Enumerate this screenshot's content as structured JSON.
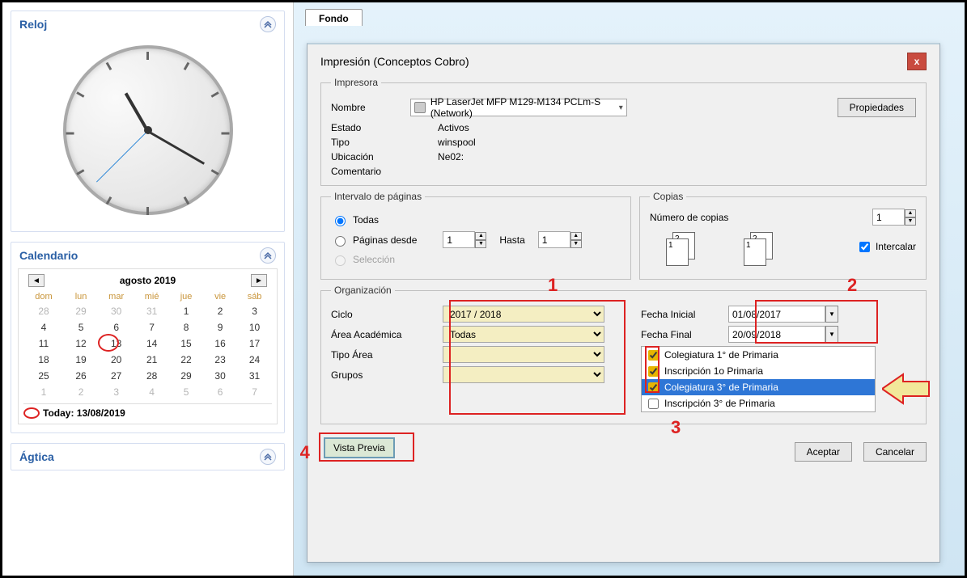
{
  "sidebar": {
    "clock_title": "Reloj",
    "calendar_title": "Calendario",
    "agtica_title": "Ágtica",
    "calendar": {
      "month_label": "agosto 2019",
      "today_label": "Today: 13/08/2019",
      "dow": [
        "dom",
        "lun",
        "mar",
        "mié",
        "jue",
        "vie",
        "sáb"
      ],
      "weeks": [
        [
          {
            "d": "28",
            "dim": true
          },
          {
            "d": "29",
            "dim": true
          },
          {
            "d": "30",
            "dim": true
          },
          {
            "d": "31",
            "dim": true
          },
          {
            "d": "1"
          },
          {
            "d": "2"
          },
          {
            "d": "3"
          }
        ],
        [
          {
            "d": "4"
          },
          {
            "d": "5"
          },
          {
            "d": "6"
          },
          {
            "d": "7"
          },
          {
            "d": "8"
          },
          {
            "d": "9"
          },
          {
            "d": "10"
          }
        ],
        [
          {
            "d": "11"
          },
          {
            "d": "12"
          },
          {
            "d": "13",
            "today": true
          },
          {
            "d": "14"
          },
          {
            "d": "15"
          },
          {
            "d": "16"
          },
          {
            "d": "17"
          }
        ],
        [
          {
            "d": "18"
          },
          {
            "d": "19"
          },
          {
            "d": "20"
          },
          {
            "d": "21"
          },
          {
            "d": "22"
          },
          {
            "d": "23"
          },
          {
            "d": "24"
          }
        ],
        [
          {
            "d": "25"
          },
          {
            "d": "26"
          },
          {
            "d": "27"
          },
          {
            "d": "28"
          },
          {
            "d": "29"
          },
          {
            "d": "30"
          },
          {
            "d": "31"
          }
        ],
        [
          {
            "d": "1",
            "dim": true
          },
          {
            "d": "2",
            "dim": true
          },
          {
            "d": "3",
            "dim": true
          },
          {
            "d": "4",
            "dim": true
          },
          {
            "d": "5",
            "dim": true
          },
          {
            "d": "6",
            "dim": true
          },
          {
            "d": "7",
            "dim": true
          }
        ]
      ]
    }
  },
  "tab": {
    "fondo": "Fondo"
  },
  "dialog": {
    "title": "Impresión (Conceptos Cobro)",
    "close": "x",
    "printer": {
      "legend": "Impresora",
      "name_label": "Nombre",
      "name_value": "HP LaserJet MFP M129-M134 PCLm-S (Network)",
      "props_btn": "Propiedades",
      "state_label": "Estado",
      "state_value": "Activos",
      "type_label": "Tipo",
      "type_value": "winspool",
      "loc_label": "Ubicación",
      "loc_value": "Ne02:",
      "comment_label": "Comentario",
      "comment_value": ""
    },
    "pages": {
      "legend": "Intervalo de páginas",
      "all": "Todas",
      "range": "Páginas desde",
      "to": "Hasta",
      "from_val": "1",
      "to_val": "1",
      "selection": "Selección"
    },
    "copies": {
      "legend": "Copias",
      "count_label": "Número de copias",
      "count_value": "1",
      "collate": "Intercalar",
      "page_a": "1",
      "page_b": "2"
    },
    "org": {
      "legend": "Organización",
      "ciclo_label": "Ciclo",
      "ciclo_value": "2017 / 2018",
      "area_label": "Área Académica",
      "area_value": "Todas",
      "tipo_label": "Tipo Área",
      "tipo_value": "",
      "grupos_label": "Grupos",
      "grupos_value": "",
      "fecha_ini_label": "Fecha Inicial",
      "fecha_ini_value": "01/08/2017",
      "fecha_fin_label": "Fecha Final",
      "fecha_fin_value": "20/09/2018",
      "concepts": [
        {
          "label": "Colegiatura 1° de Primaria",
          "checked": true,
          "selected": false
        },
        {
          "label": "Inscripción 1o Primaria",
          "checked": true,
          "selected": false
        },
        {
          "label": "Colegiatura 3° de Primaria",
          "checked": true,
          "selected": true
        },
        {
          "label": "Inscripción 3° de Primaria",
          "checked": false,
          "selected": false
        }
      ]
    },
    "annotations": {
      "n1": "1",
      "n2": "2",
      "n3": "3",
      "n4": "4"
    },
    "footer": {
      "vista": "Vista Previa",
      "aceptar": "Aceptar",
      "cancelar": "Cancelar"
    }
  }
}
